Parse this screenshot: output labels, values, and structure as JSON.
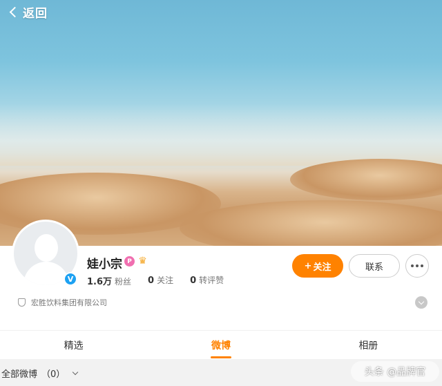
{
  "nav": {
    "back_label": "返回"
  },
  "profile": {
    "name": "娃小宗",
    "badge_p": "P",
    "verified_mark": "V",
    "stats": [
      {
        "value": "1.6万",
        "label": "粉丝"
      },
      {
        "value": "0",
        "label": "关注"
      },
      {
        "value": "0",
        "label": "转评赞"
      }
    ],
    "company": "宏胜饮料集团有限公司"
  },
  "actions": {
    "follow_plus": "+",
    "follow_label": "关注",
    "contact_label": "联系"
  },
  "tabs": [
    {
      "label": "精选",
      "active": false
    },
    {
      "label": "微博",
      "active": true
    },
    {
      "label": "相册",
      "active": false
    }
  ],
  "filter": {
    "label": "全部微博",
    "count": "（0）"
  },
  "watermark": "头条 @品牌官",
  "colors": {
    "accent": "#ff8200",
    "verified": "#1da1f2",
    "badge_p": "#f06fb0"
  }
}
